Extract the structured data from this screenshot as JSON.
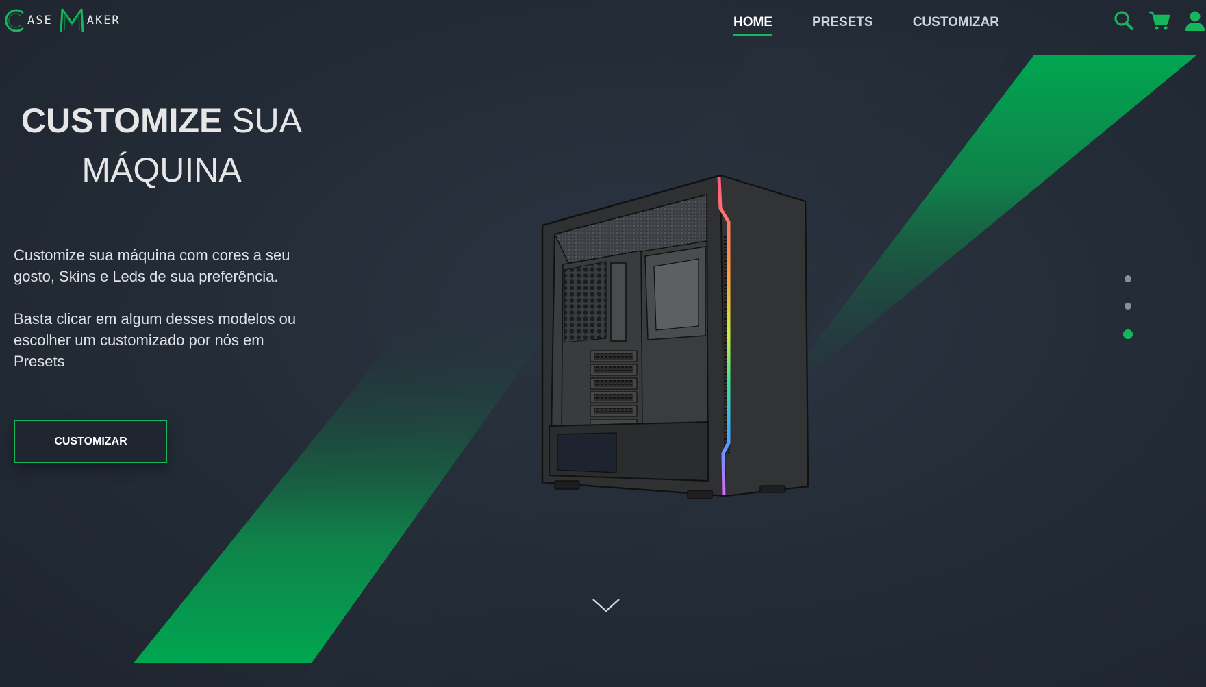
{
  "brand": {
    "logo_part1_initial": "C",
    "logo_part1_rest": "ASE",
    "logo_part2_initial": "M",
    "logo_part2_rest": "AKER",
    "accent_color": "#16b75c",
    "background_color": "#222a35"
  },
  "nav": {
    "items": [
      {
        "label": "HOME",
        "active": true
      },
      {
        "label": "PRESETS",
        "active": false
      },
      {
        "label": "CUSTOMIZAR",
        "active": false
      }
    ]
  },
  "header_icons": [
    "search-icon",
    "cart-icon",
    "user-icon"
  ],
  "hero": {
    "title_strong": "CUSTOMIZE",
    "title_rest_line1": " SUA",
    "title_line2": "MÁQUINA",
    "paragraph1": "Customize sua máquina com cores a seu gosto, Skins e Leds de sua preferência.",
    "paragraph2": "Basta clicar em algum desses modelos ou escolher um customizado por nós em Presets",
    "cta_label": "CUSTOMIZAR"
  },
  "slider": {
    "total": 3,
    "active_index": 2,
    "dot_color": "#8a8f96",
    "active_color": "#16b75c"
  },
  "scroll_indicator_icon": "chevron-down-icon"
}
